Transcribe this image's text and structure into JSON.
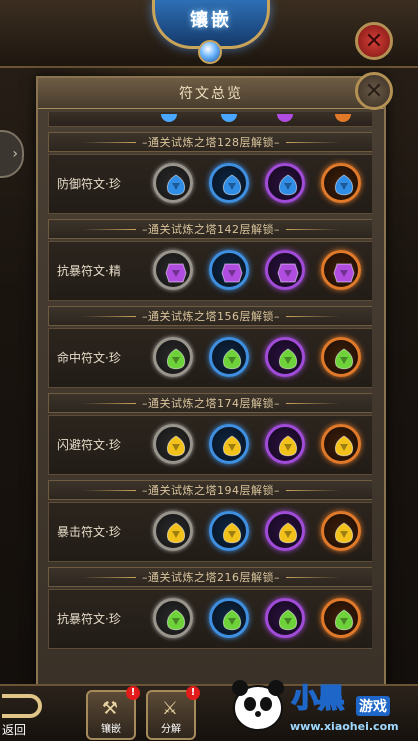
{
  "header": {
    "title": "镶嵌"
  },
  "panel": {
    "title": "符文总览"
  },
  "slot_colors": [
    "gray",
    "blue",
    "purple",
    "orange"
  ],
  "gem_colors": {
    "blue": "#2f8de6",
    "purple": "#b04de0",
    "green": "#6ed23a",
    "yellow": "#f2c21b"
  },
  "sections": [
    {
      "unlock": "–通关试炼之塔128层解锁–",
      "rune": "防御符文·珍",
      "gem": "blue"
    },
    {
      "unlock": "–通关试炼之塔142层解锁–",
      "rune": "抗暴符文·精",
      "gem": "purple"
    },
    {
      "unlock": "–通关试炼之塔156层解锁–",
      "rune": "命中符文·珍",
      "gem": "green"
    },
    {
      "unlock": "–通关试炼之塔174层解锁–",
      "rune": "闪避符文·珍",
      "gem": "yellow"
    },
    {
      "unlock": "–通关试炼之塔194层解锁–",
      "rune": "暴击符文·珍",
      "gem": "yellow"
    },
    {
      "unlock": "–通关试炼之塔216层解锁–",
      "rune": "抗暴符文·珍",
      "gem": "green"
    }
  ],
  "bottom": {
    "back_label": "返回",
    "tabs": [
      {
        "label": "镶嵌",
        "badge": "!"
      },
      {
        "label": "分解",
        "badge": "!"
      }
    ]
  },
  "watermark": {
    "text": "小黑",
    "game": "游戏",
    "url": "www.xiaohei.com"
  }
}
